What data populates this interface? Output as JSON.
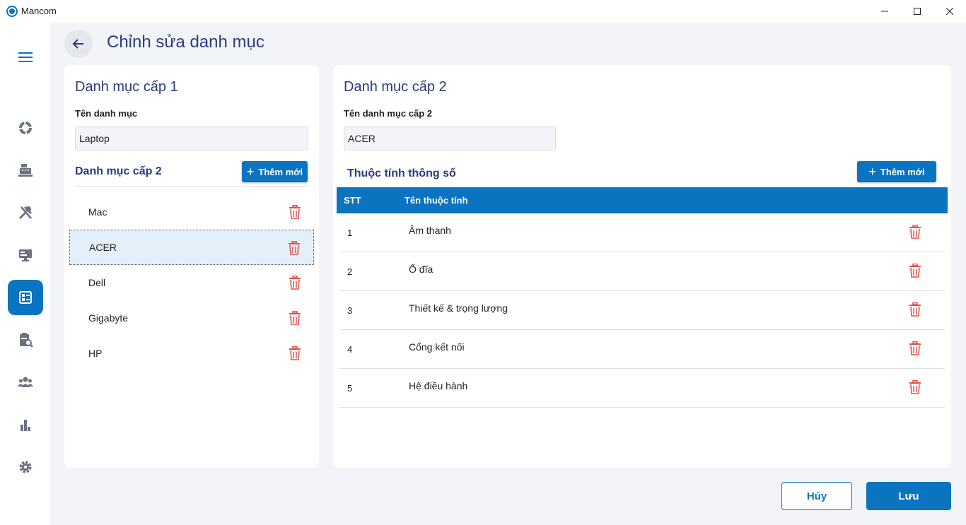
{
  "window": {
    "app_title": "Mancom"
  },
  "colors": {
    "accent": "#0b74c1",
    "heading": "#2d3a7c",
    "delete": "#e0534a",
    "background": "#f3f4f8"
  },
  "sidebar": {
    "items": [
      {
        "icon": "menu-icon"
      },
      {
        "icon": "dashboard-icon"
      },
      {
        "icon": "cash-register-icon"
      },
      {
        "icon": "tools-icon"
      },
      {
        "icon": "monitor-icon"
      },
      {
        "icon": "category-icon",
        "active": true
      },
      {
        "icon": "clipboard-search-icon"
      },
      {
        "icon": "users-icon"
      },
      {
        "icon": "bar-chart-icon"
      },
      {
        "icon": "gear-icon"
      }
    ]
  },
  "page": {
    "title": "Chỉnh sửa danh mục"
  },
  "level1": {
    "heading": "Danh mục cấp 1",
    "name_label": "Tên danh mục",
    "name_value": "Laptop",
    "sub_heading": "Danh mục cấp 2",
    "add_label": "Thêm mới",
    "items": [
      {
        "label": "Mac"
      },
      {
        "label": "ACER",
        "selected": true
      },
      {
        "label": "Dell"
      },
      {
        "label": "Gigabyte"
      },
      {
        "label": "HP"
      }
    ]
  },
  "level2": {
    "heading": "Danh mục cấp 2",
    "name_label": "Tên danh mục cấp 2",
    "name_value": "ACER",
    "attributes_heading": "Thuộc tính thông số",
    "add_label": "Thêm mới",
    "columns": [
      "STT",
      "Tên thuộc tính"
    ],
    "rows": [
      {
        "stt": "1",
        "name": "Âm thanh"
      },
      {
        "stt": "2",
        "name": "Ổ đĩa"
      },
      {
        "stt": "3",
        "name": "Thiết kế & trọng lượng"
      },
      {
        "stt": "4",
        "name": "Cổng kết nối"
      },
      {
        "stt": "5",
        "name": "Hệ điều hành"
      }
    ]
  },
  "footer": {
    "cancel_label": "Hủy",
    "save_label": "Lưu"
  }
}
